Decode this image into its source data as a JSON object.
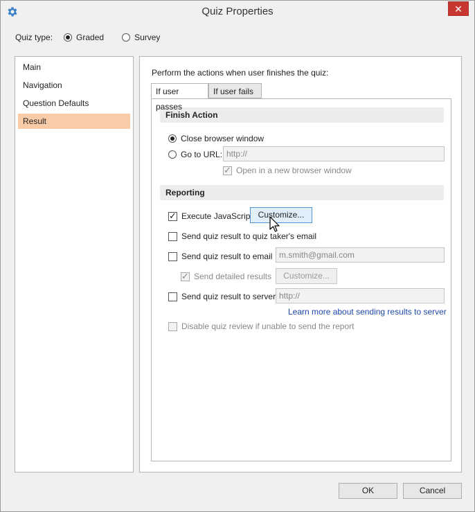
{
  "window": {
    "title": "Quiz Properties",
    "close_glyph": "✕"
  },
  "quiz_type": {
    "label": "Quiz type:",
    "options": [
      {
        "label": "Graded",
        "selected": true
      },
      {
        "label": "Survey",
        "selected": false
      }
    ]
  },
  "sidebar": {
    "items": [
      {
        "label": "Main",
        "selected": false
      },
      {
        "label": "Navigation",
        "selected": false
      },
      {
        "label": "Question Defaults",
        "selected": false
      },
      {
        "label": "Result",
        "selected": true
      }
    ]
  },
  "main": {
    "perform_text": "Perform the actions when user finishes the quiz:",
    "tabs": [
      {
        "label": "If user passes",
        "active": true
      },
      {
        "label": "If user fails",
        "active": false
      }
    ],
    "finish_action": {
      "header": "Finish Action",
      "close_browser_label": "Close browser window",
      "goto_url_label": "Go to URL:",
      "url_placeholder": "http://",
      "open_new_window_label": "Open in a new browser window"
    },
    "reporting": {
      "header": "Reporting",
      "execute_js_label": "Execute JavaScript",
      "customize_label": "Customize...",
      "send_to_taker_label": "Send quiz result to quiz taker's email",
      "send_to_email_label": "Send quiz result to email",
      "email_value": "m.smith@gmail.com",
      "send_detailed_label": "Send detailed results",
      "customize2_label": "Customize...",
      "send_to_server_label": "Send quiz result to server",
      "server_placeholder": "http://",
      "learn_more_link": "Learn more about sending results to server",
      "disable_review_label": "Disable quiz review if unable to send the report"
    }
  },
  "footer": {
    "ok_label": "OK",
    "cancel_label": "Cancel"
  },
  "colors": {
    "selected_item": "#f9cba6",
    "close_button": "#c7372f",
    "link": "#1d47a8",
    "gear_icon": "#3a7fc8"
  },
  "icons": {
    "app": "gear-icon",
    "cursor": "mouse-pointer-icon"
  }
}
